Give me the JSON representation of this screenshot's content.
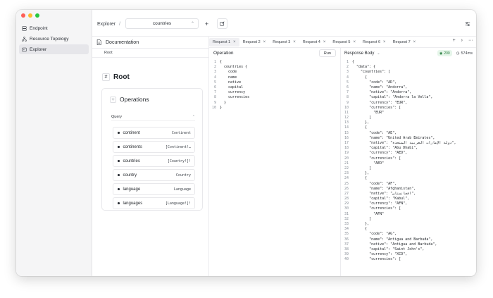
{
  "sidebar": {
    "items": [
      {
        "label": "Endpoint",
        "icon": "server-icon"
      },
      {
        "label": "Resource Topology",
        "icon": "topology-icon"
      },
      {
        "label": "Explorer",
        "icon": "explorer-icon"
      }
    ]
  },
  "topbar": {
    "title": "Explorer",
    "separator": "/",
    "selected_endpoint": "countries"
  },
  "docs": {
    "header": "Documentation",
    "breadcrumb": "Root",
    "root_title": "Root",
    "operations_title": "Operations",
    "query_label": "Query",
    "fields": [
      {
        "name": "continent",
        "type": "Continent"
      },
      {
        "name": "continents",
        "type": "[Continent!…"
      },
      {
        "name": "countries",
        "type": "[Country!]!"
      },
      {
        "name": "country",
        "type": "Country"
      },
      {
        "name": "language",
        "type": "Language"
      },
      {
        "name": "languages",
        "type": "[Language!]!"
      }
    ]
  },
  "tabs": [
    {
      "label": "Request 1",
      "active": true
    },
    {
      "label": "Request 2"
    },
    {
      "label": "Request 3"
    },
    {
      "label": "Request 4"
    },
    {
      "label": "Request 5"
    },
    {
      "label": "Request 6"
    },
    {
      "label": "Request 7"
    }
  ],
  "operation": {
    "title": "Operation",
    "run_label": "Run",
    "lines": [
      "{",
      "  countries {",
      "    code",
      "    name",
      "    native",
      "    capital",
      "    currency",
      "    currencies",
      "  }",
      "}"
    ]
  },
  "response": {
    "title": "Response Body",
    "status": "200",
    "time": "574ms",
    "lines": [
      "{",
      "  \"data\": {",
      "    \"countries\": [",
      "      {",
      "        \"code\": \"AD\",",
      "        \"name\": \"Andorra\",",
      "        \"native\": \"Andorra\",",
      "        \"capital\": \"Andorra la Vella\",",
      "        \"currency\": \"EUR\",",
      "        \"currencies\": [",
      "          \"EUR\"",
      "        ]",
      "      },",
      "      {",
      "        \"code\": \"AE\",",
      "        \"name\": \"United Arab Emirates\",",
      "        \"native\": \"دولة الإمارات العربية المتحدة\",",
      "        \"capital\": \"Abu Dhabi\",",
      "        \"currency\": \"AED\",",
      "        \"currencies\": [",
      "          \"AED\"",
      "        ]",
      "      },",
      "      {",
      "        \"code\": \"AF\",",
      "        \"name\": \"Afghanistan\",",
      "        \"native\": \"افغانستان\",",
      "        \"capital\": \"Kabul\",",
      "        \"currency\": \"AFN\",",
      "        \"currencies\": [",
      "          \"AFN\"",
      "        ]",
      "      },",
      "      {",
      "        \"code\": \"AG\",",
      "        \"name\": \"Antigua and Barbuda\",",
      "        \"native\": \"Antigua and Barbuda\",",
      "        \"capital\": \"Saint John's\",",
      "        \"currency\": \"XCD\",",
      "        \"currencies\": ["
    ]
  },
  "colors": {
    "status_bg": "#e6f6ea",
    "status_fg": "#237a3a",
    "sidebar_bg": "#f5f5f6"
  }
}
